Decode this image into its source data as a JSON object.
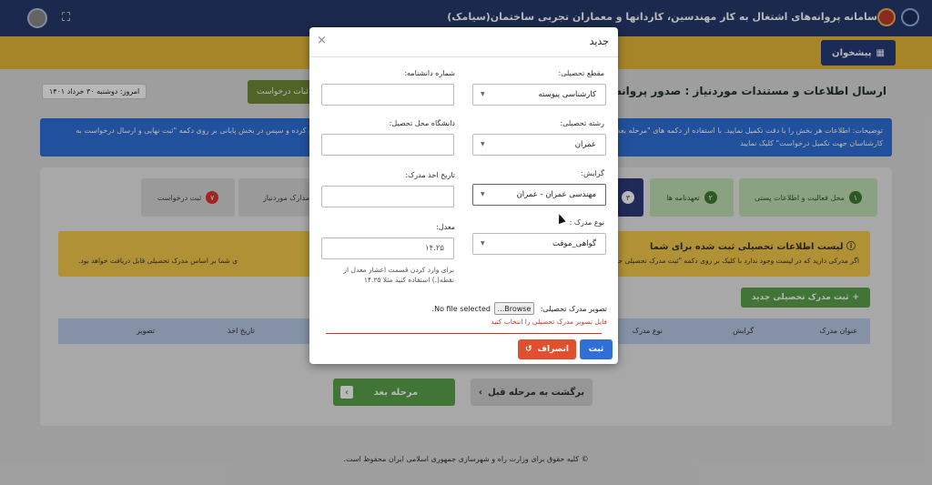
{
  "header": {
    "title": "سامانه پروانه‌های اشتغال به کار مهندسین، کاردانها و معماران تجربی ساختمان(سیامک)",
    "fullscreen_icon": "fullscreen-icon",
    "pishkhan_label": "پیشخوان"
  },
  "page": {
    "title": "ارسال اطلاعات و مستندات موردنیاز : صدور پروانه اش",
    "date_text": "امروز: دوشنبه ۳۰ خرداد ۱۴۰۱",
    "green_top_btn": "ثبات درخواست",
    "info_text": "توضیحات: اطلاعات هر بخش را با دقت تکمیل نمایید. با استفاده از دکمه های \"مرحله بعد\" و \"برگشت به مرحله قبل\" بین بخش ها جابجا شوید. توجه داشته باشید که باید تمامی بخشها را تکمیل کرده و سپس در بخش پایانی بر روی دکمه \"ثبت نهایی و ارسال درخواست به کارشناسان جهت تکمیل درخواست\" کلیک نمایید"
  },
  "steps": [
    {
      "num": "۱",
      "label": "محل فعالیت و اطلاعات پستی"
    },
    {
      "num": "۲",
      "label": "تعهدنامه ها"
    },
    {
      "num": "۳",
      "label": ""
    },
    {
      "num": "",
      "label": "مدارک موردنیاز"
    },
    {
      "num": "۷",
      "label": "ثبت درخواست"
    }
  ],
  "warning": {
    "title": "لیست اطلاعات تحصیلی ثبت شده برای شما",
    "text_right": "اگر مدرکی دارید که در لیست وجود ندارد با کلیک بر روی دکمه \"ثبت مدرک تحصیلی جدید\" اقدام نمایید",
    "text_left": "ی شما بر اساس مدرک تحصیلی قابل دریافت خواهد بود."
  },
  "add_button": "ثبت مدرک تحصیلی جدید",
  "table": {
    "headers": [
      "عنوان مدرک",
      "گرایش",
      "نوع مدرک",
      "تاریخ اخذ",
      "تصویر"
    ]
  },
  "nav": {
    "next": "مرحله بعد",
    "prev": "برگشت به مرحله قبل"
  },
  "footer": "© کلیه حقوق برای وزارت راه و شهرسازی جمهوری اسلامی ایران محفوظ است.",
  "modal": {
    "title": "جدید",
    "degree_level_label": "مقطع تحصیلی:",
    "degree_level_value": "کارشناسی پیوسته",
    "degree_number_label": "شماره دانشنامه:",
    "degree_number_value": "",
    "field_label": "رشته تحصیلی:",
    "field_value": "عمران",
    "university_label": "دانشگاه محل تحصیل:",
    "university_value": "",
    "orientation_label": "گرایش:",
    "orientation_value": "مهندسی عمران - عمران",
    "date_label": "تاریخ اخذ مدرک:",
    "date_value": "",
    "doc_type_label": "نوع مدرک :",
    "doc_type_value": "گواهی_موقت",
    "gpa_label": "معدل:",
    "gpa_value": "۱۴.۲۵",
    "gpa_help": "برای وارد کردن قسمت اعشار معدل از نقطه(.) استفاده کنید مثلا ۱۴.۲۵",
    "image_label": "تصویر مدرک تحصیلی:",
    "browse_label": "Browse...",
    "no_file": "No file selected.",
    "file_error": "فایل تصویر مدرک تحصیلی را انتخاب کنید",
    "submit_label": "ثبت",
    "cancel_label": "انصراف"
  },
  "colors": {
    "header": "#25396b",
    "yellow": "#e6b93a",
    "blue": "#2f6fd8",
    "green": "#5aa24a",
    "danger": "#e0502e"
  }
}
